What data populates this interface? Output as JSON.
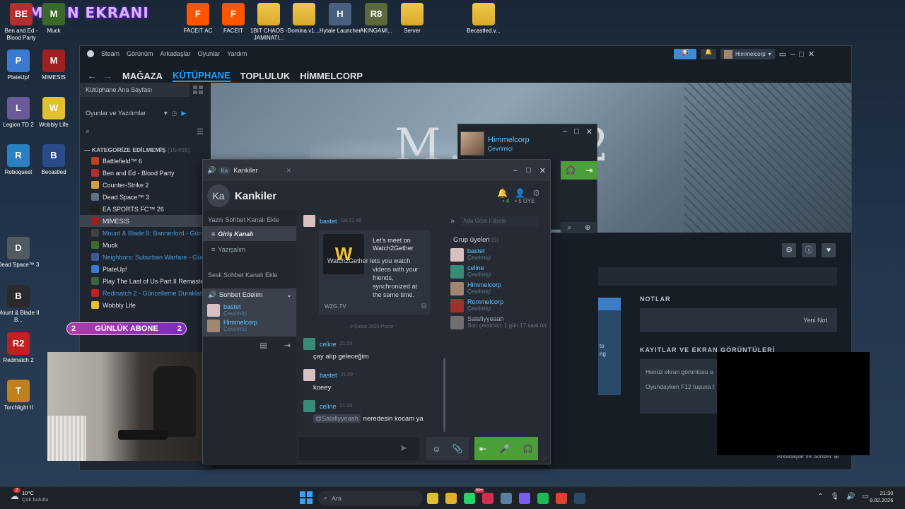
{
  "stream_title": "EMİRİN EKRANI",
  "desktop_icons": [
    {
      "label": "Ben and Ed - Blood Party",
      "color": "#b03030",
      "glyph": "BE"
    },
    {
      "label": "Muck",
      "color": "#3a6a2a",
      "glyph": "M"
    },
    {
      "label": "FACEIT AC",
      "color": "#ff5500",
      "glyph": "F"
    },
    {
      "label": "FACEIT",
      "color": "#ff5500",
      "glyph": "F"
    },
    {
      "label": "1BIT CHAOS - JAMINATI...",
      "color": "folder",
      "glyph": ""
    },
    {
      "label": "Domina.v1....",
      "color": "folder",
      "glyph": ""
    },
    {
      "label": "Hytale Launcher",
      "color": "#4a6080",
      "glyph": "H"
    },
    {
      "label": "AKINGAMI...",
      "color": "#5a6a3a",
      "glyph": "R8"
    },
    {
      "label": "Server",
      "color": "folder",
      "glyph": ""
    },
    {
      "label": "Becastled.v...",
      "color": "folder",
      "glyph": ""
    },
    {
      "label": "PlateUp!",
      "color": "#3a7ad0",
      "glyph": "P"
    },
    {
      "label": "MIMESIS",
      "color": "#a02020",
      "glyph": "M"
    },
    {
      "label": "Legion TD 2",
      "color": "#6a5a9a",
      "glyph": "L"
    },
    {
      "label": "Wobbly Life",
      "color": "#e0c030",
      "glyph": "W"
    },
    {
      "label": "Roboquest",
      "color": "#2a80c0",
      "glyph": "R"
    },
    {
      "label": "Becastled",
      "color": "#2a4a8a",
      "glyph": "B"
    },
    {
      "label": "Dead Space™ 3",
      "color": "#505a60",
      "glyph": "D"
    },
    {
      "label": "Mount & Blade II B...",
      "color": "#2a2a2a",
      "glyph": "B"
    },
    {
      "label": "Redmatch 2",
      "color": "#c02020",
      "glyph": "R2"
    },
    {
      "label": "Torchlight II",
      "color": "#c08020",
      "glyph": "T"
    }
  ],
  "subscriber_badge": {
    "count_left": "2",
    "label": "GÜNLÜK ABONE",
    "count_right": "2"
  },
  "steam": {
    "menu": [
      "Steam",
      "Görünüm",
      "Arkadaşlar",
      "Oyunlar",
      "Yardım"
    ],
    "nav": [
      "MAĞAZA",
      "KÜTÜPHANE",
      "TOPLULUK",
      "HİMMELCORP"
    ],
    "user": "Himmelcorp",
    "library_home": "Kütüphane Ana Sayfası",
    "filter": "Oyunlar ve Yazılımlar",
    "category": "KATEGORİZE EDİLMEMİŞ",
    "category_count": "(15/455)",
    "games": [
      {
        "name": "Battlefield™ 6",
        "color": "#c04020",
        "state": ""
      },
      {
        "name": "Ben and Ed - Blood Party",
        "color": "#b03030",
        "state": ""
      },
      {
        "name": "Counter-Strike 2",
        "color": "#d0a040",
        "state": ""
      },
      {
        "name": "Dead Space™ 3",
        "color": "#607080",
        "state": ""
      },
      {
        "name": "EA SPORTS FC™ 26",
        "color": "#202020",
        "state": ""
      },
      {
        "name": "MIMESIS",
        "color": "#a02020",
        "state": "sel"
      },
      {
        "name": "Mount & Blade II: Bannerlord - Günc",
        "color": "#404040",
        "state": "upd"
      },
      {
        "name": "Muck",
        "color": "#3a6a2a",
        "state": ""
      },
      {
        "name": "Neighbors: Suburban Warfare - Gün",
        "color": "#3a5a9a",
        "state": "upd"
      },
      {
        "name": "PlateUp!",
        "color": "#3a7ad0",
        "state": ""
      },
      {
        "name": "Play The Last of Us Part II Remaster",
        "color": "#406040",
        "state": ""
      },
      {
        "name": "Redmatch 2 - Güncelleme Duraklat",
        "color": "#c02020",
        "state": "upd"
      },
      {
        "name": "Wobbly Life",
        "color": "#e0c030",
        "state": ""
      }
    ],
    "hero_title": "M...  I 2",
    "notes_label": "NOTLAR",
    "new_note": "Yeni Not",
    "screens_label": "KAYITLAR VE EKRAN GÖRÜNTÜLERİ",
    "screens_line1": "Henüz ekran görüntüsü a",
    "screens_line2": "Oyundayken F12 tuşuna t",
    "partial_to": "to",
    "partial_ng": "ng",
    "friends_chat": "Arkadaşlar ve Sohbet"
  },
  "friend_popup": {
    "name": "Himmelcorp",
    "status": "Çevrimiçi"
  },
  "chat": {
    "tab": "Kankiler",
    "tab_initials": "Ka",
    "group_name": "Kankiler",
    "online_count": "4",
    "member_count": "5 ÜYE",
    "add_text_channel": "Yazılı Sohbet Kanalı Ekle",
    "channels": [
      "Giriş Kanalı",
      "Yazışalım"
    ],
    "add_voice_channel": "Sesli Sohbet Kanalı Ekle",
    "voice_channel": "Sohbet Edelim",
    "voice_users": [
      {
        "name": "bastet",
        "status": "Çevrimiçi",
        "color": "#d8c0c0"
      },
      {
        "name": "Himmelcorp",
        "status": "Çevrimiçi",
        "color": "#a08870"
      }
    ],
    "first_sender": "bastet",
    "first_time": "Sal 21:48",
    "embed": {
      "title": "Let's meet on Watch2Gether",
      "desc": "Watch2Gether lets you watch videos with your friends, synchronized at the same time.",
      "domain": "W2G.TV",
      "logo": "W"
    },
    "date_divider": "8 Şubat 2026 Pazar",
    "messages": [
      {
        "user": "celine",
        "time": "21:29",
        "text": "çay alıp geleceğim",
        "mention": "",
        "color": "#3a8a7a"
      },
      {
        "user": "bastet",
        "time": "21:29",
        "text": "koeey",
        "mention": "",
        "color": "#d8c0c0"
      },
      {
        "user": "celine",
        "time": "21:29",
        "text": "neredesin kocam ya",
        "mention": "@Salafiyyeaah",
        "color": "#3a8a7a"
      }
    ],
    "member_search_placeholder": "Ada Göre Filtrele",
    "members_title": "Grup üyeleri",
    "members_count": "(5)",
    "members": [
      {
        "name": "bastet",
        "status": "Çevrimiçi",
        "color": "#d8c0c0",
        "offline": false
      },
      {
        "name": "celine",
        "status": "Çevrimiçi",
        "color": "#3a8a7a",
        "offline": false
      },
      {
        "name": "Himmelcorp",
        "status": "Çevrimiçi",
        "color": "#a08870",
        "offline": false
      },
      {
        "name": "Rommelcorp",
        "status": "Çevrimiçi",
        "color": "#a03030",
        "offline": false
      },
      {
        "name": "Salafiyyeaah",
        "status": "Son çevrimiçi: 1 gün 17 saat ön",
        "color": "#707070",
        "offline": true
      }
    ]
  },
  "taskbar": {
    "weather_temp": "10°C",
    "weather_desc": "Çok bulutlu",
    "notification_count": "2",
    "search_placeholder": "Ara",
    "time": "21:30",
    "date": "8.02.2026",
    "badge_99": "99+"
  }
}
